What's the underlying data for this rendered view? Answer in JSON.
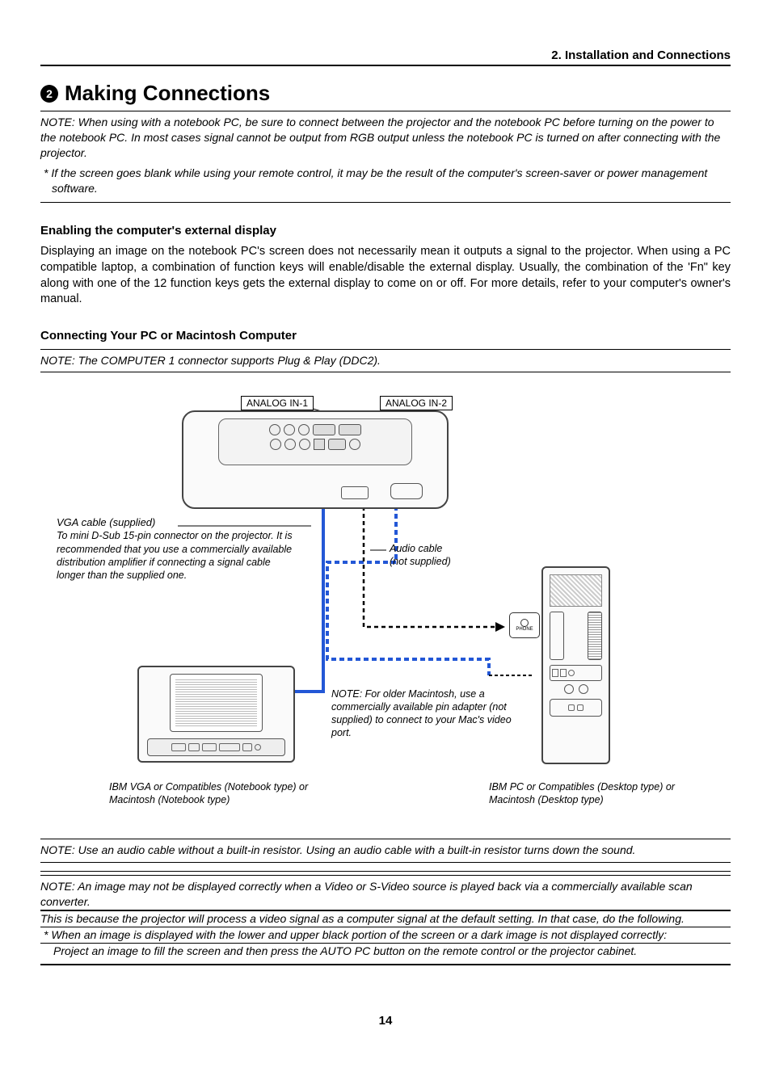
{
  "header": {
    "section": "2. Installation and Connections"
  },
  "title": {
    "number": "2",
    "text": "Making Connections"
  },
  "notes": {
    "top1": "NOTE: When using with a notebook PC, be sure to connect between the projector and the notebook PC before turning on the power to the notebook PC. In most cases signal cannot be output from RGB output unless the notebook PC is turned on after connecting with the projector.",
    "top2": "* If the screen goes blank while using your remote control, it may be the result of the computer's screen-saver or power management software."
  },
  "sections": {
    "s1_heading": "Enabling the computer's external display",
    "s1_body": "Displaying an image on the notebook PC's screen does not necessarily mean it outputs a signal to the projector. When using a PC compatible laptop, a combination of function keys will enable/disable the external display. Usually, the combination of the 'Fn\" key along with one of the 12 function keys gets the external display to come on or off. For more details, refer to your computer's owner's manual.",
    "s2_heading": "Connecting Your PC or Macintosh Computer",
    "s2_note": "NOTE: The COMPUTER 1 connector supports Plug & Play (DDC2)."
  },
  "diagram": {
    "analog1": "ANALOG IN-1",
    "analog2": "ANALOG IN-2",
    "vga_head": "VGA cable (supplied)",
    "vga_body": "To mini D-Sub 15-pin connector on the projector. It is recommended that you use a commercially available distribution amplifier if connecting a signal cable longer than the supplied one.",
    "audio_head": "Audio cable",
    "audio_body": "(not supplied)",
    "mac_note": "NOTE: For older Macintosh, use a commercially available pin adapter (not supplied) to connect to your Mac's video port.",
    "laptop_caption": "IBM VGA or Compatibles (Notebook type) or Macintosh (Notebook type)",
    "desktop_caption": "IBM PC or Compatibles (Desktop type) or Macintosh (Desktop type)",
    "phone": "PHONE"
  },
  "bottom": {
    "n1": "NOTE: Use an audio cable without a built-in resistor. Using an audio cable with a built-in resistor turns down the sound.",
    "n2": "NOTE: An image may not be displayed correctly when a Video or S-Video source is played back via a commercially available scan converter.",
    "n3": "This is because the projector will process a video signal as a computer signal at the default setting. In that case, do the following.",
    "n4": "* When an image is displayed with the lower and upper black portion of the screen or a dark image is not displayed correctly:",
    "n5": "Project an image to fill the screen and then press the AUTO PC button on the remote control or the projector cabinet."
  },
  "page": "14"
}
